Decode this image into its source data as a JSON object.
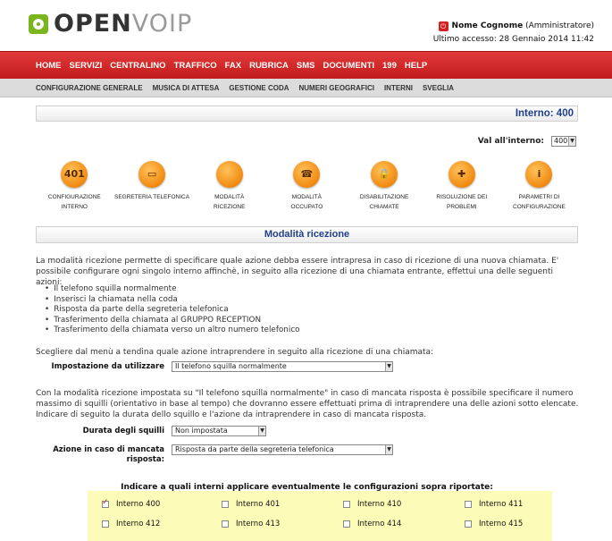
{
  "header": {
    "logo_open": "OPEN",
    "logo_voip": "VOIP",
    "user_name": "Nome Cognome",
    "user_role": "(Amministratore)",
    "last_access": "Ultimo accesso: 28 Gennaio 2014 11:42"
  },
  "mainnav": [
    "HOME",
    "SERVIZI",
    "CENTRALINO",
    "TRAFFICO",
    "FAX",
    "RUBRICA",
    "SMS",
    "DOCUMENTI",
    "199",
    "HELP"
  ],
  "subnav": [
    "CONFIGURAZIONE GENERALE",
    "MUSICA DI ATTESA",
    "GESTIONE CODA",
    "NUMERI GEOGRAFICI",
    "INTERNI",
    "SVEGLIA"
  ],
  "interno_title": "Interno: 400",
  "val_interno": {
    "label": "Val all'interno:",
    "value": "400"
  },
  "icons": [
    {
      "label1": "CONFIGURAZIONE",
      "label2": "INTERNO",
      "glyph": "401"
    },
    {
      "label1": "SEGRETERIA TELEFONICA",
      "label2": "",
      "glyph": "▭"
    },
    {
      "label1": "MODALITÀ",
      "label2": "RICEZIONE",
      "glyph": ""
    },
    {
      "label1": "MODALITÀ",
      "label2": "OCCUPATO",
      "glyph": "☎"
    },
    {
      "label1": "DISABILITAZIONE",
      "label2": "CHIAMATE",
      "glyph": "🔒"
    },
    {
      "label1": "RISOLUZIONE DEI",
      "label2": "PROBLEMI",
      "glyph": "✚"
    },
    {
      "label1": "PARAMETRI DI",
      "label2": "CONFIGURAZIONE",
      "glyph": "i"
    }
  ],
  "section_title": "Modalità ricezione",
  "intro_text": "La modalità ricezione permette di specificare quale azione debba essere intrapresa in caso di ricezione di una nuova chiamata. E' possibile configurare ogni singolo interno affinchè, in seguito alla ricezione di una chiamata entrante, effettui una delle seguenti azioni:",
  "bullets": [
    "Il telefono squilla normalmente",
    "Inserisci la chiamata nella coda",
    "Risposta da parte della segreteria telefonica",
    "Trasferimento della chiamata al GRUPPO RECEPTION",
    "Trasferimento della chiamata verso un altro numero telefonico"
  ],
  "choose_text": "Scegliere dal menù a tendina quale azione intraprendere in seguito alla ricezione di una chiamata:",
  "impostazione": {
    "label": "Impostazione da utilizzare",
    "value": "Il telefono squilla normalmente"
  },
  "mancata_text": "Con la modalità ricezione impostata su \"Il telefono squilla normalmente\" in caso di mancata risposta è possibile specificare il numero massimo di squilli (orientativo in base al tempo) che dovranno essere effettuati prima di intraprendere una delle azioni sotto elencate. Indicare di seguito la durata dello squillo e l'azione da intraprendere in caso di mancata risposta.",
  "durata": {
    "label": "Durata degli squilli",
    "value": "Non impostata"
  },
  "azione": {
    "label1": "Azione in caso di mancata",
    "label2": "risposta:",
    "value": "Risposta da parte della segreteria telefonica"
  },
  "checks_title": "Indicare a quali interni applicare eventualmente le configurazioni sopra riportate:",
  "checks": [
    {
      "label": "Interno 400",
      "checked": true
    },
    {
      "label": "Interno 401",
      "checked": false
    },
    {
      "label": "Interno 410",
      "checked": false
    },
    {
      "label": "Interno 411",
      "checked": false
    },
    {
      "label": "Interno 412",
      "checked": false
    },
    {
      "label": "Interno 413",
      "checked": false
    },
    {
      "label": "Interno 414",
      "checked": false
    },
    {
      "label": "Interno 415",
      "checked": false
    }
  ]
}
